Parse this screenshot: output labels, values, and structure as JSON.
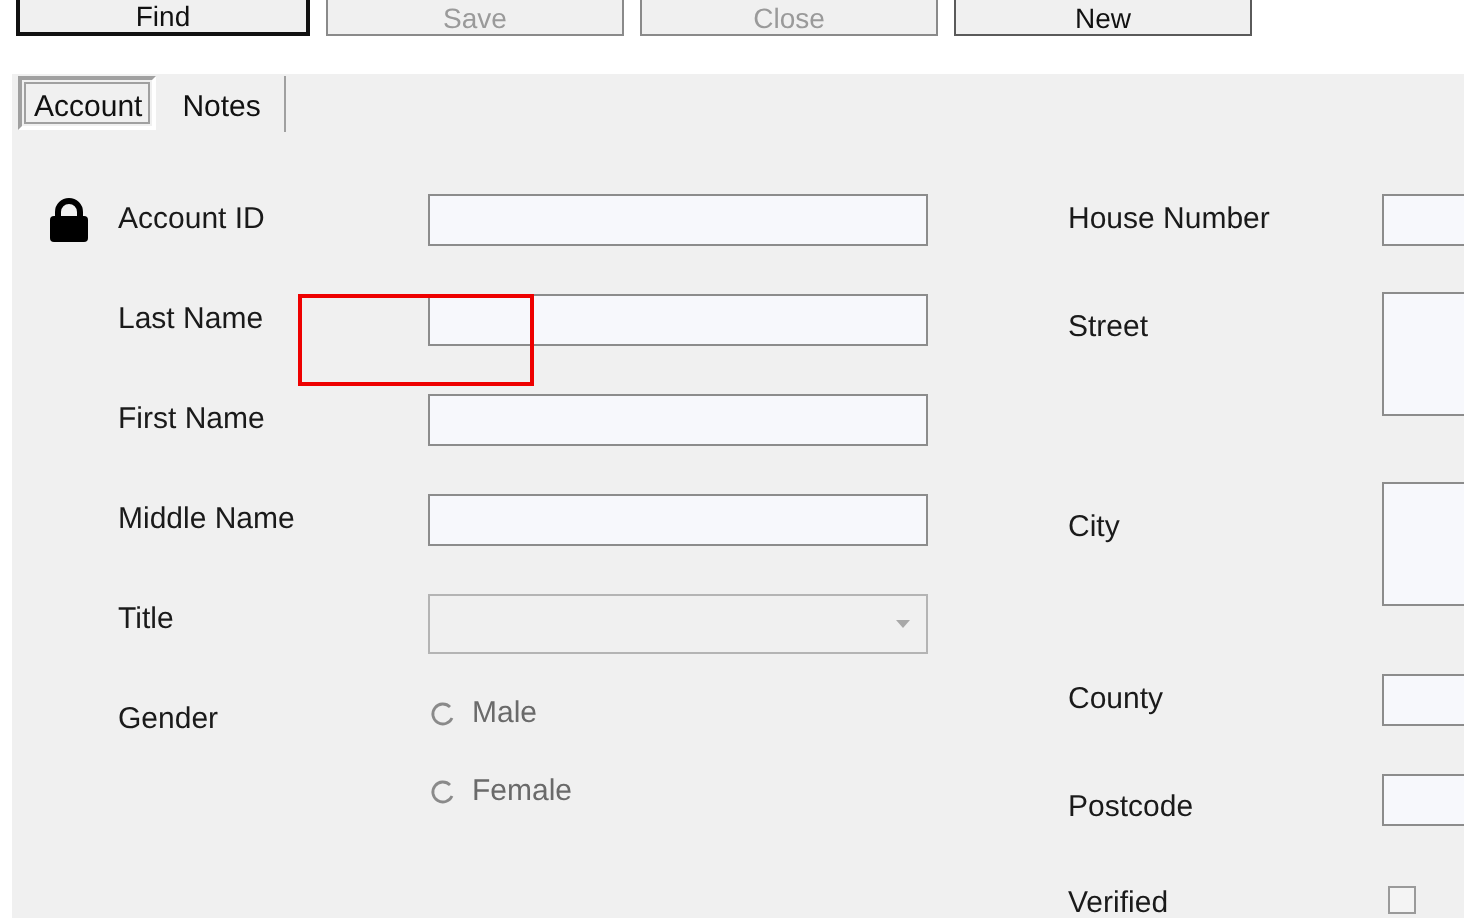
{
  "toolbar": [
    {
      "label": "Find",
      "default": true,
      "disabled": false
    },
    {
      "label": "Save",
      "default": false,
      "disabled": true
    },
    {
      "label": "Close",
      "default": false,
      "disabled": true
    },
    {
      "label": "New",
      "default": false,
      "disabled": false
    }
  ],
  "tabs": [
    {
      "label": "Account",
      "selected": true
    },
    {
      "label": "Notes",
      "selected": false
    }
  ],
  "left_fields": [
    {
      "label": "Account ID",
      "kind": "text",
      "locked": true
    },
    {
      "label": "Last Name",
      "kind": "text"
    },
    {
      "label": "First Name",
      "kind": "text"
    },
    {
      "label": "Middle Name",
      "kind": "text"
    },
    {
      "label": "Title",
      "kind": "combo",
      "disabled": true
    },
    {
      "label": "Gender",
      "kind": "radio",
      "disabled": true,
      "options": [
        {
          "label": "Male",
          "selected": false
        },
        {
          "label": "Female",
          "selected": false
        }
      ]
    }
  ],
  "right_fields": [
    {
      "label": "House Number",
      "kind": "text"
    },
    {
      "label": "Street",
      "kind": "textarea"
    },
    {
      "label": "City",
      "kind": "textarea"
    },
    {
      "label": "County",
      "kind": "text"
    },
    {
      "label": "Postcode",
      "kind": "text"
    },
    {
      "label": "Verified",
      "kind": "checkbox",
      "checked": false
    }
  ]
}
